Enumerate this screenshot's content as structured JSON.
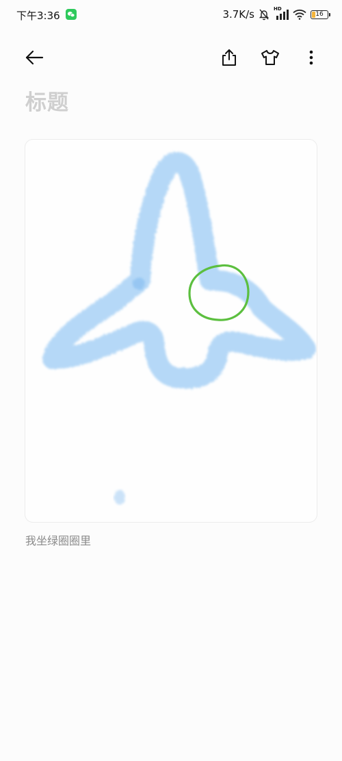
{
  "status_bar": {
    "time": "下午3:36",
    "network_speed": "3.7K/s",
    "signal_label": "HD",
    "battery_level": "16",
    "icons": [
      "wechat-icon",
      "bell-muted-icon",
      "signal-icon",
      "wifi-icon",
      "battery-icon"
    ]
  },
  "toolbar": {
    "back_icon": "arrow-left-icon",
    "share_icon": "share-icon",
    "theme_icon": "tshirt-icon",
    "more_icon": "more-vertical-icon"
  },
  "note": {
    "title_placeholder": "标题",
    "caption": "我坐绿圈圈里"
  },
  "colors": {
    "stroke_blue": "#a9d2f6",
    "circle_green": "#5cbf3f",
    "placeholder_gray": "#cfcfcf"
  }
}
